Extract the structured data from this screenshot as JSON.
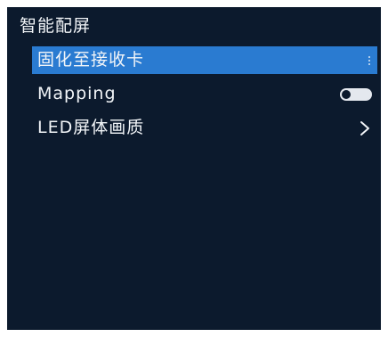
{
  "header": {
    "title": "智能配屏"
  },
  "menu": {
    "items": [
      {
        "label": "固化至接收卡",
        "selected": true,
        "accessory": "more-vertical-icon"
      },
      {
        "label": "Mapping",
        "selected": false,
        "accessory": "toggle",
        "toggle_on": false
      },
      {
        "label": "LED屏体画质",
        "selected": false,
        "accessory": "chevron-right-icon"
      }
    ]
  },
  "colors": {
    "background": "#0c1a2d",
    "selection": "#2a7bd1",
    "text": "#f2f5f8"
  }
}
